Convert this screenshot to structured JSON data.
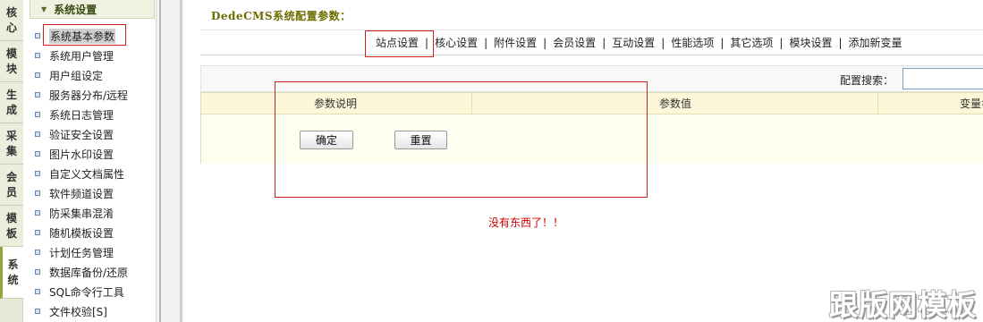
{
  "vtabs": [
    {
      "line1": "核",
      "line2": "心"
    },
    {
      "line1": "模",
      "line2": "块"
    },
    {
      "line1": "生",
      "line2": "成"
    },
    {
      "line1": "采",
      "line2": "集"
    },
    {
      "line1": "会",
      "line2": "员"
    },
    {
      "line1": "模",
      "line2": "板"
    },
    {
      "line1": "系",
      "line2": "统"
    }
  ],
  "menu": {
    "heading": "系统设置",
    "items": [
      "系统基本参数",
      "系统用户管理",
      "用户组设定",
      "服务器分布/远程",
      "系统日志管理",
      "验证安全设置",
      "图片水印设置",
      "自定义文档属性",
      "软件频道设置",
      "防采集串混淆",
      "随机模板设置",
      "计划任务管理",
      "数据库备份/还原",
      "SQL命令行工具",
      "文件校验[S]"
    ]
  },
  "main": {
    "title": "DedeCMS系统配置参数：",
    "tabs": [
      "站点设置",
      "核心设置",
      "附件设置",
      "会员设置",
      "互动设置",
      "性能选项",
      "其它选项",
      "模块设置",
      "添加新变量"
    ],
    "search_label": "配置搜索：",
    "search_value": "",
    "table_headers": {
      "desc": "参数说明",
      "value": "参数值",
      "var": "变量名"
    },
    "buttons": {
      "confirm": "确定",
      "reset": "重置"
    },
    "empty_message": "没有东西了！！"
  },
  "watermark": "跟版网模板",
  "colors": {
    "highlight_box": "#d0201c",
    "title": "#6d6d00",
    "empty_message": "#cc0000"
  }
}
